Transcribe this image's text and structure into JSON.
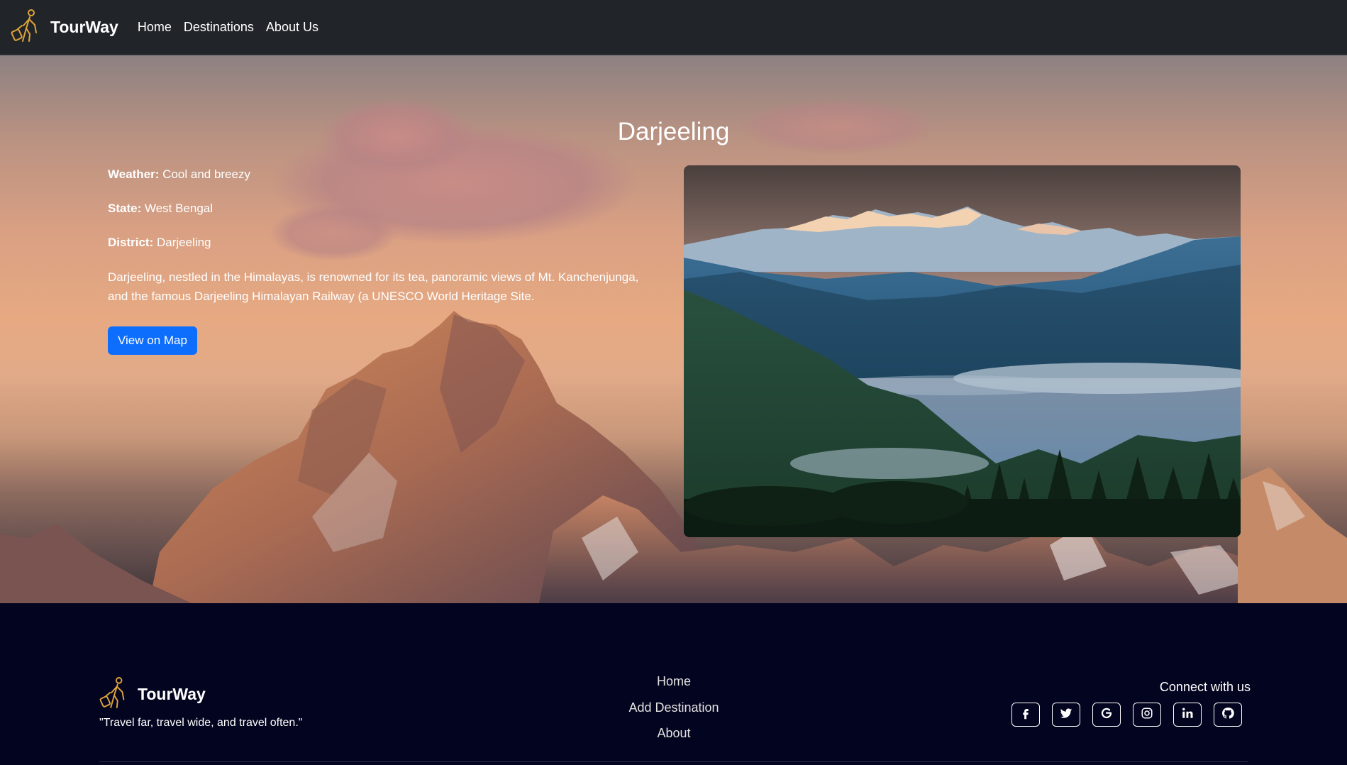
{
  "navbar": {
    "brand": "TourWay",
    "links": [
      "Home",
      "Destinations",
      "About Us"
    ]
  },
  "destination": {
    "name": "Darjeeling",
    "weather_label": "Weather:",
    "weather": "Cool and breezy",
    "state_label": "State:",
    "state": "West Bengal",
    "district_label": "District:",
    "district": "Darjeeling",
    "description": "Darjeeling, nestled in the Himalayas, is renowned for its tea, panoramic views of Mt. Kanchenjunga, and the famous Darjeeling Himalayan Railway (a UNESCO World Heritage Site.",
    "map_button": "View on Map"
  },
  "footer": {
    "brand": "TourWay",
    "tagline": "\"Travel far, travel wide, and travel often.\"",
    "links": [
      "Home",
      "Add Destination",
      "About"
    ],
    "connect_label": "Connect with us",
    "socials": [
      "facebook-icon",
      "twitter-icon",
      "google-icon",
      "instagram-icon",
      "linkedin-icon",
      "github-icon"
    ]
  },
  "colors": {
    "navbar_bg": "#212529",
    "footer_bg": "#03041f",
    "primary_button": "#0d6efd",
    "logo_gold": "#e0a43a"
  }
}
